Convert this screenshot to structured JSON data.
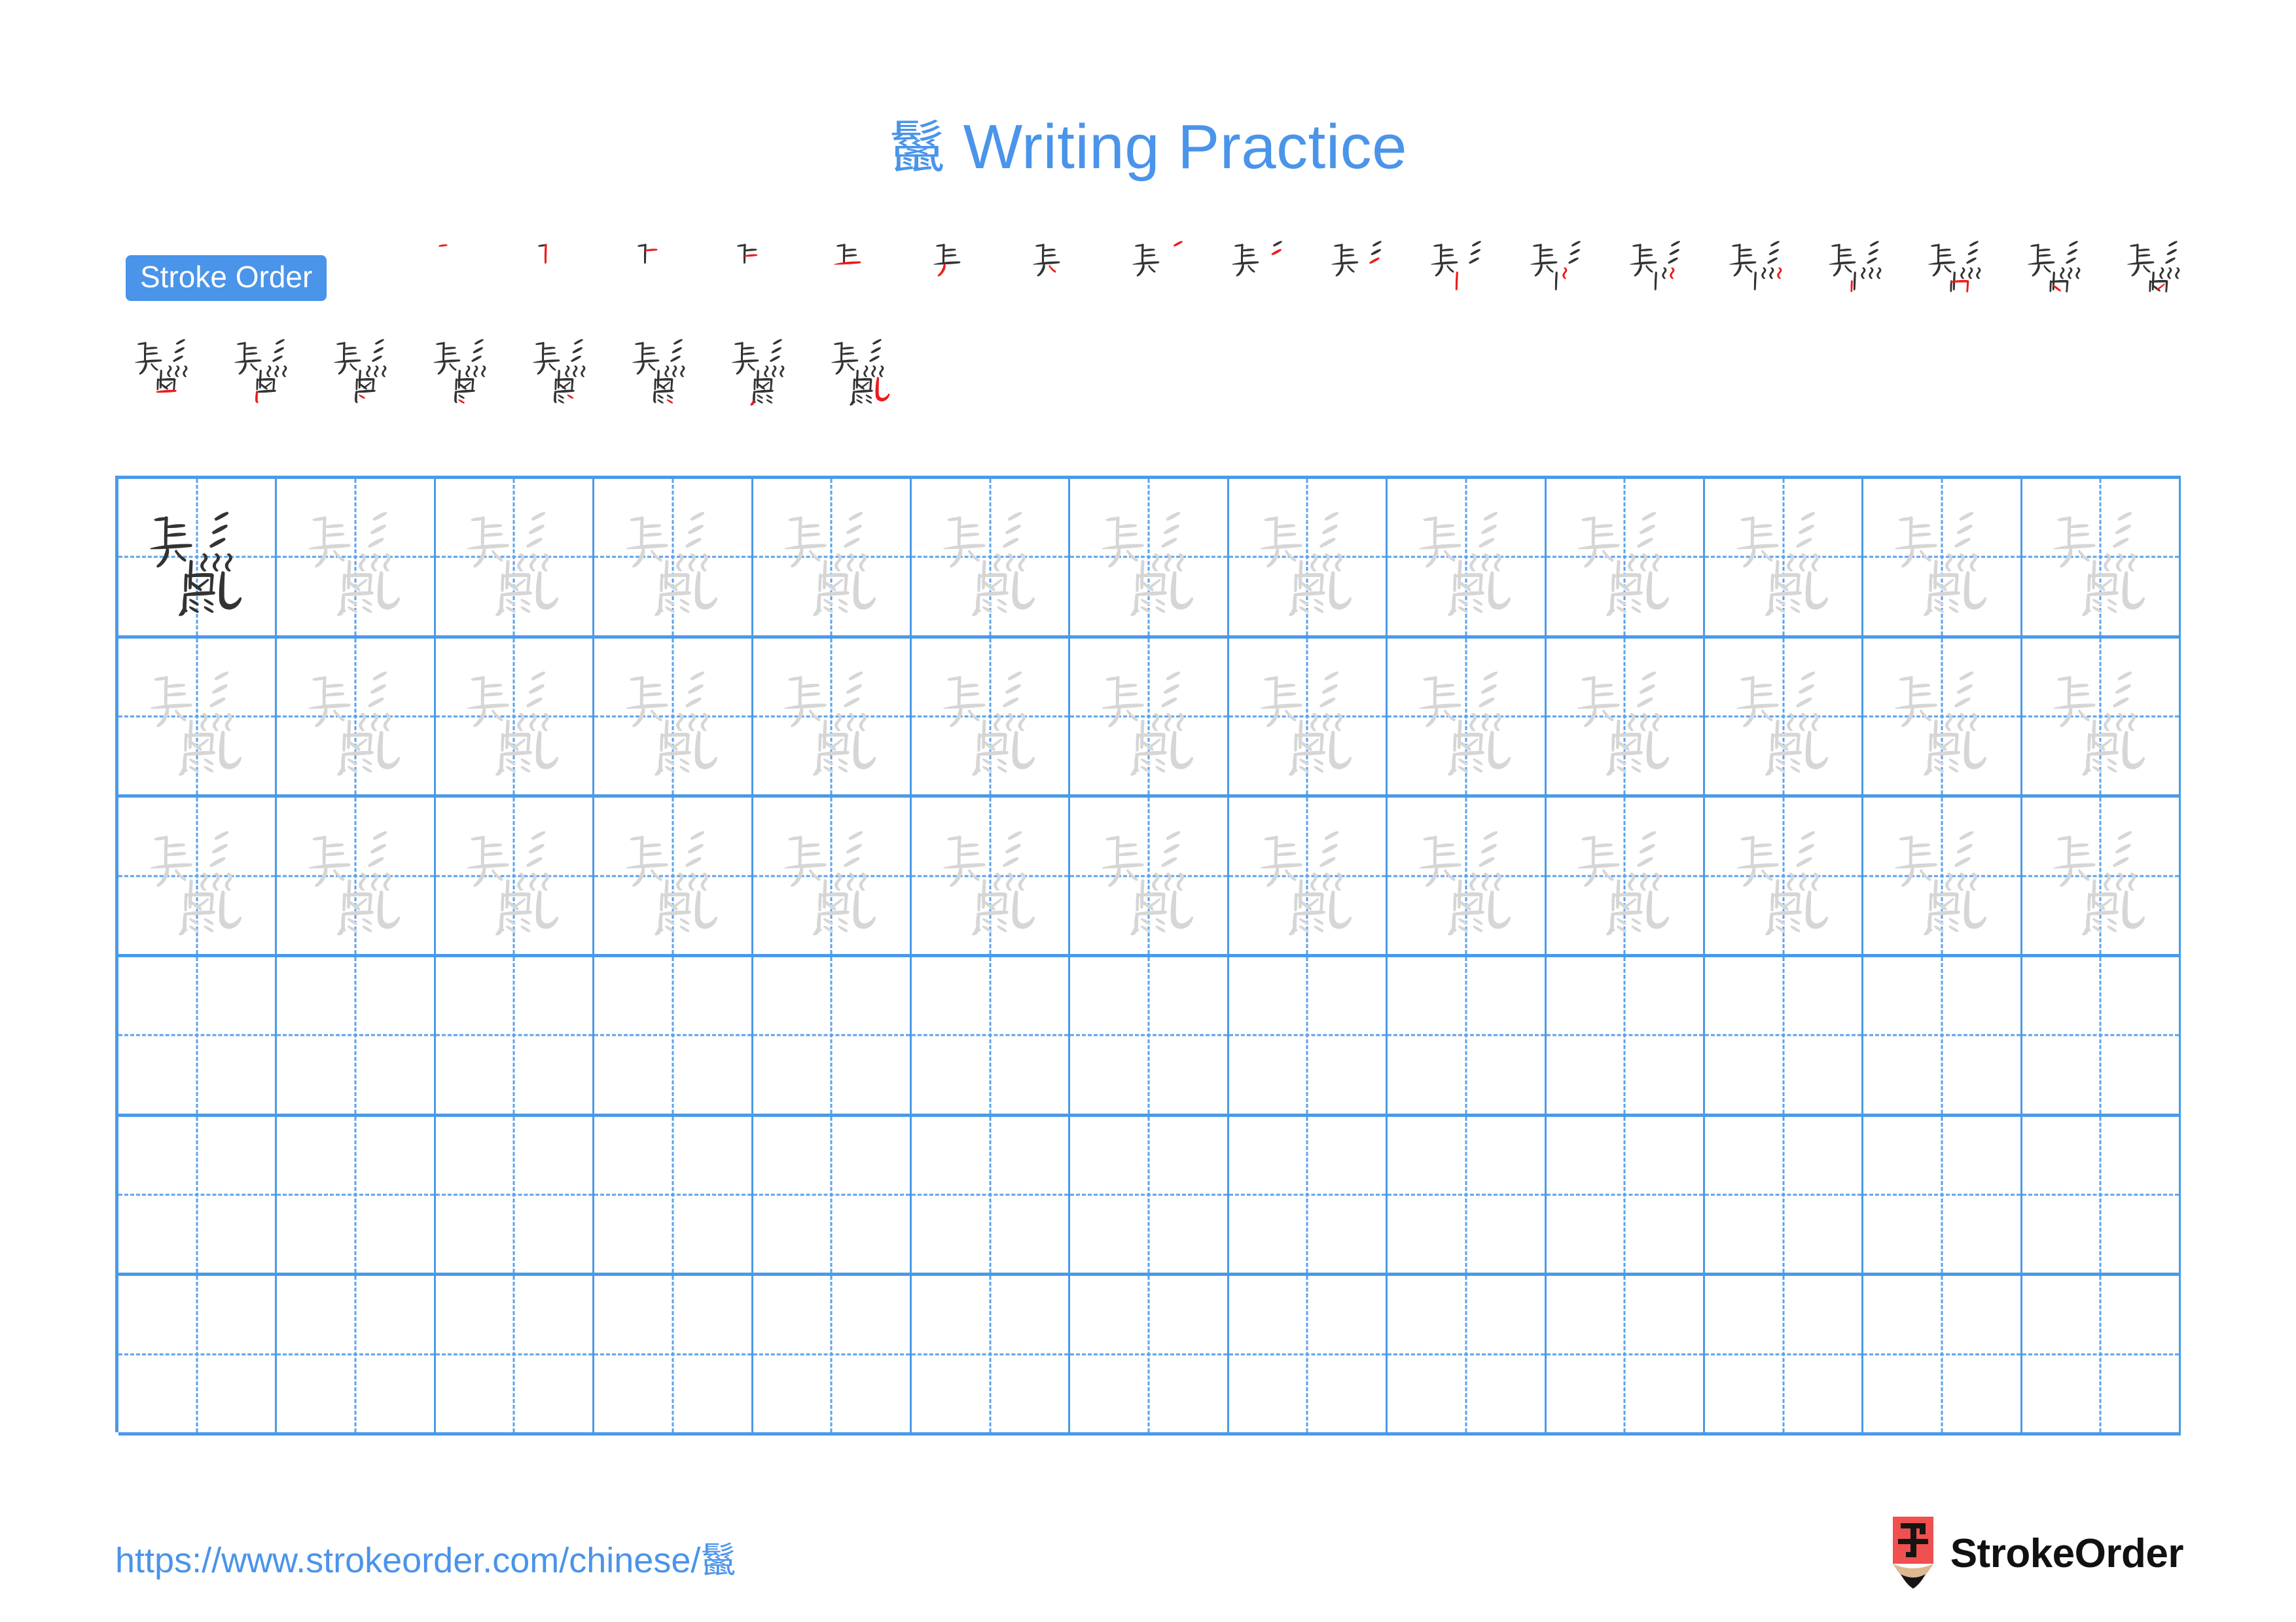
{
  "document": {
    "character": "鬣",
    "title_suffix": "Writing Practice",
    "title_full": "鬣 Writing Practice"
  },
  "stroke_order": {
    "badge_label": "Stroke Order",
    "total_strokes": 26,
    "row_1_steps": 18,
    "row_2_steps": 8,
    "accent_color": "#4a94ea",
    "new_stroke_color": "#ee1b1b",
    "existing_stroke_color": "#333333"
  },
  "practice_grid": {
    "columns": 13,
    "rows": 6,
    "rows_with_tracing": 3,
    "model_character_cell": {
      "row": 1,
      "column": 1
    },
    "model_character_color": "#333333",
    "tracing_character_color": "#d6d6d6",
    "grid_line_color": "#4a9ae8",
    "guide_line_color": "#5aa3ec"
  },
  "footer": {
    "url": "https://www.strokeorder.com/chinese/鬣",
    "url_color": "#4a94ea",
    "brand_name": "StrokeOrder",
    "brand_glyph": "字",
    "brand_mark_color": "#f05050",
    "brand_mark_wood_color": "#dcb991",
    "brand_mark_tip_color": "#151515"
  }
}
